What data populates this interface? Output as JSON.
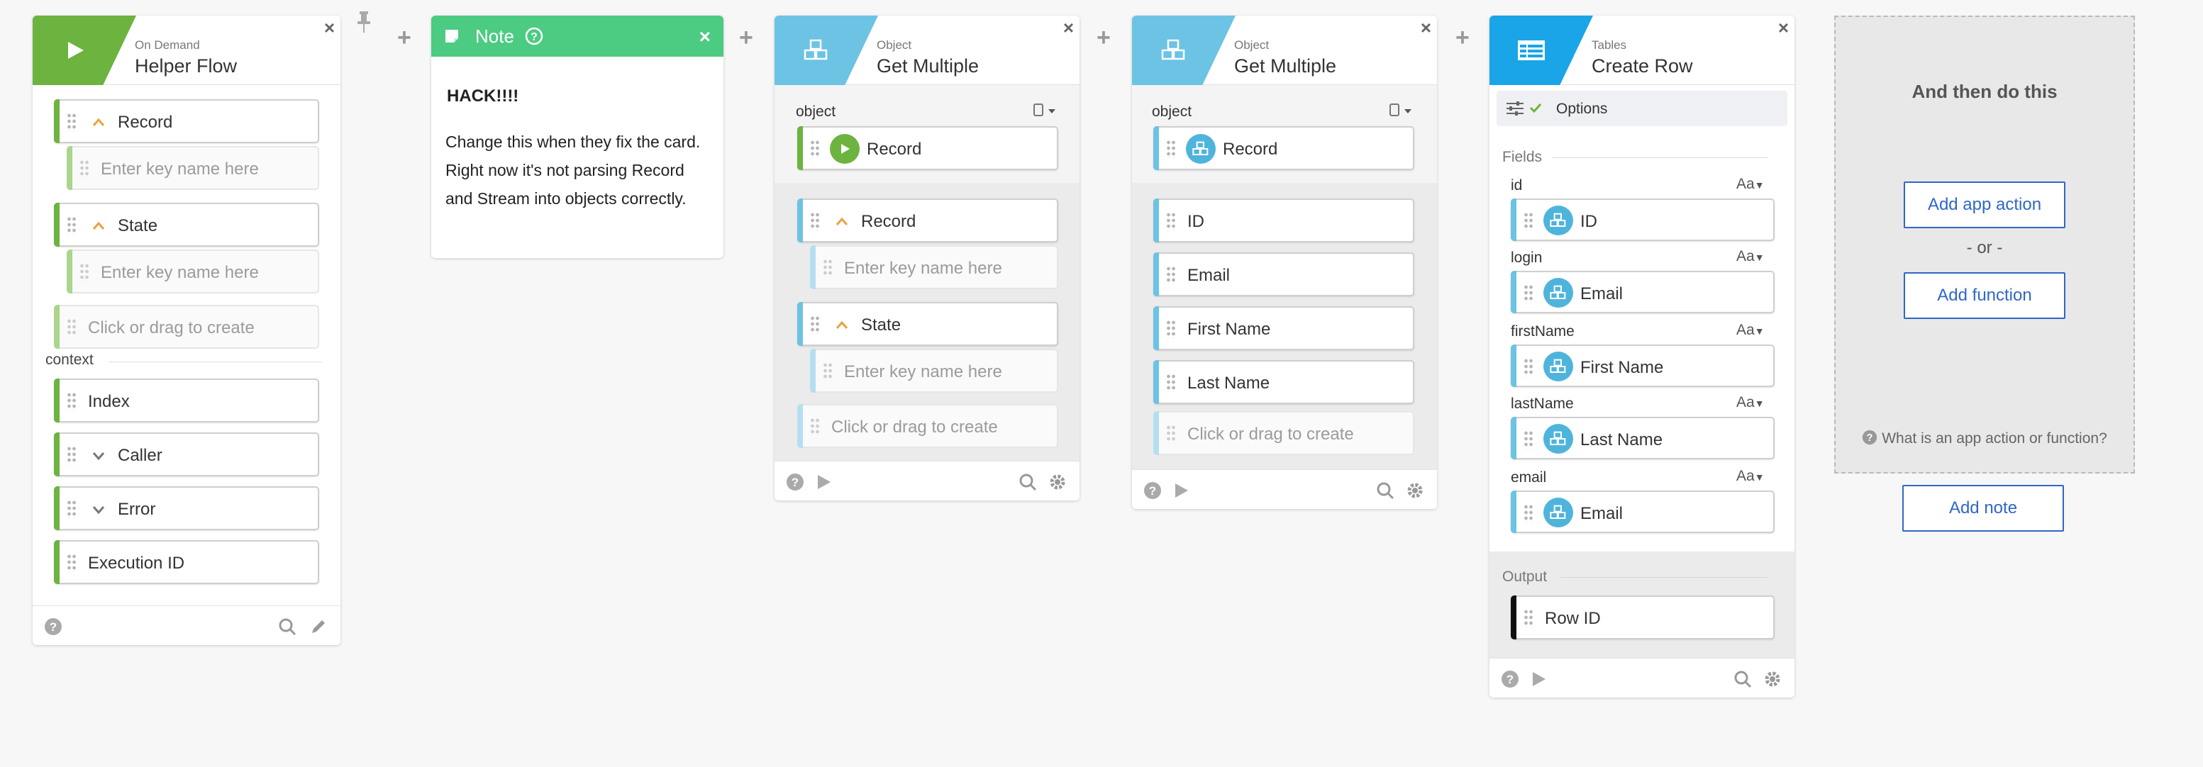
{
  "cards": {
    "helper": {
      "subtitle": "On Demand",
      "title": "Helper Flow",
      "pills": [
        "Record",
        "Enter key name here",
        "State",
        "Enter key name here",
        "Click or drag to create"
      ],
      "context_label": "context",
      "context_pills": [
        "Index",
        "Caller",
        "Error",
        "Execution ID"
      ]
    },
    "note": {
      "title": "Note",
      "heading": "HACK!!!!",
      "body": "Change this when they fix the card. Right now it's not parsing Record and Stream into objects correctly."
    },
    "get1": {
      "subtitle": "Object",
      "title": "Get Multiple",
      "object_label": "object",
      "object_value": "Record",
      "pills": [
        "Record",
        "Enter key name here",
        "State",
        "Enter key name here",
        "Click or drag to create"
      ]
    },
    "get2": {
      "subtitle": "Object",
      "title": "Get Multiple",
      "object_label": "object",
      "object_value": "Record",
      "pills": [
        "ID",
        "Email",
        "First Name",
        "Last Name",
        "Click or drag to create"
      ]
    },
    "create": {
      "subtitle": "Tables",
      "title": "Create Row",
      "options_label": "Options",
      "fields_label": "Fields",
      "type_label": "Aa",
      "fields": [
        {
          "name": "id",
          "value": "ID"
        },
        {
          "name": "login",
          "value": "Email"
        },
        {
          "name": "firstName",
          "value": "First Name"
        },
        {
          "name": "lastName",
          "value": "Last Name"
        },
        {
          "name": "email",
          "value": "Email"
        }
      ],
      "output_label": "Output",
      "output_value": "Row ID"
    }
  },
  "next_panel": {
    "title": "And then do this",
    "add_app_action": "Add app action",
    "or": "- or -",
    "add_function": "Add function",
    "help": "What is an app action or function?",
    "add_note": "Add note"
  },
  "colors": {
    "green": "#6db33f",
    "note_green": "#4ccb82",
    "object_blue": "#6cc3e4",
    "tables_blue": "#1aa5e8",
    "link_blue": "#2f67c7"
  }
}
